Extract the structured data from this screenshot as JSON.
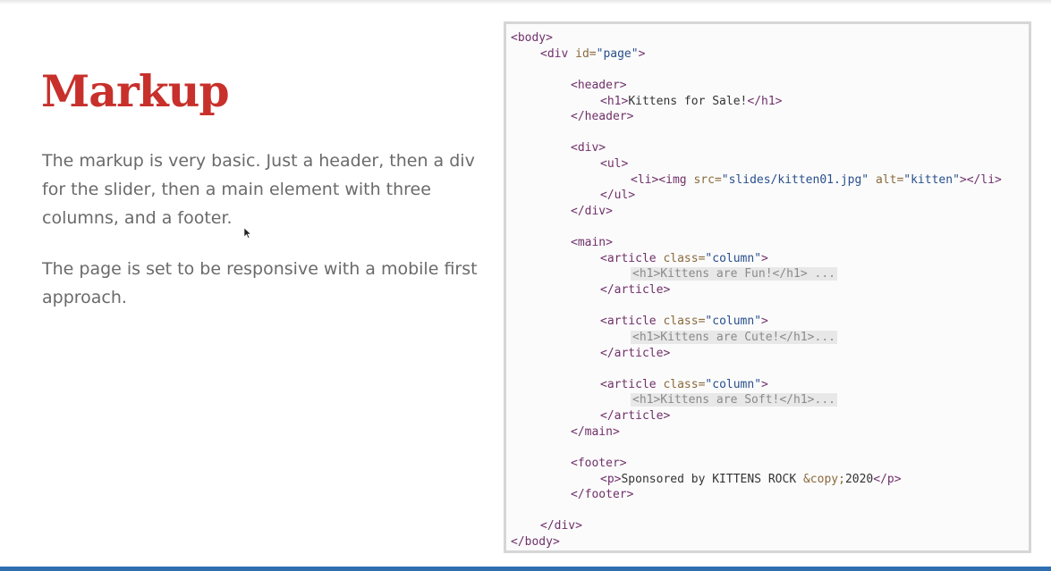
{
  "slide": {
    "title": "Markup",
    "paragraph_1": "The markup is very basic. Just a header, then a div for the slider, then a main element with three columns, and a footer.",
    "paragraph_2": "The page is set to be responsive with a mobile first approach."
  },
  "code": {
    "body_open": "<body>",
    "div_page_open": "<div ",
    "div_page_attr": "id=",
    "div_page_val": "\"page\"",
    "div_page_close": ">",
    "header_open": "<header>",
    "h1_open": "<h1>",
    "h1_text": "Kittens for Sale!",
    "h1_close": "</h1>",
    "header_close": "</header>",
    "div_open": "<div>",
    "ul_open": "<ul>",
    "li_open": "<li><img ",
    "img_src_attr": "src=",
    "img_src_val": "\"slides/kitten01.jpg\"",
    "img_alt_attr": " alt=",
    "img_alt_val": "\"kitten\"",
    "li_close": "></li>",
    "ul_close": "</ul>",
    "div_close": "</div>",
    "main_open": "<main>",
    "article_open": "<article ",
    "class_attr": "class=",
    "class_val": "\"column\"",
    "article_open_end": ">",
    "article_1_content": "<h1>Kittens are Fun!</h1> ...",
    "article_2_content": "<h1>Kittens are Cute!</h1>...",
    "article_3_content": "<h1>Kittens are Soft!</h1>...",
    "article_close": "</article>",
    "main_close": "</main>",
    "footer_open": "<footer>",
    "p_open": "<p>",
    "p_text": "Sponsored by KITTENS ROCK ",
    "p_entity": "&copy;",
    "p_year": "2020",
    "p_close": "</p>",
    "footer_close": "</footer>",
    "div_page_end": "</div>",
    "body_close": "</body>"
  },
  "colors": {
    "title": "#c8302b",
    "body_text": "#6a6a6a",
    "tag": "#70306a",
    "attribute": "#8a6a3c",
    "value": "#284f8c",
    "bottom_rule": "#2f6fb0"
  }
}
